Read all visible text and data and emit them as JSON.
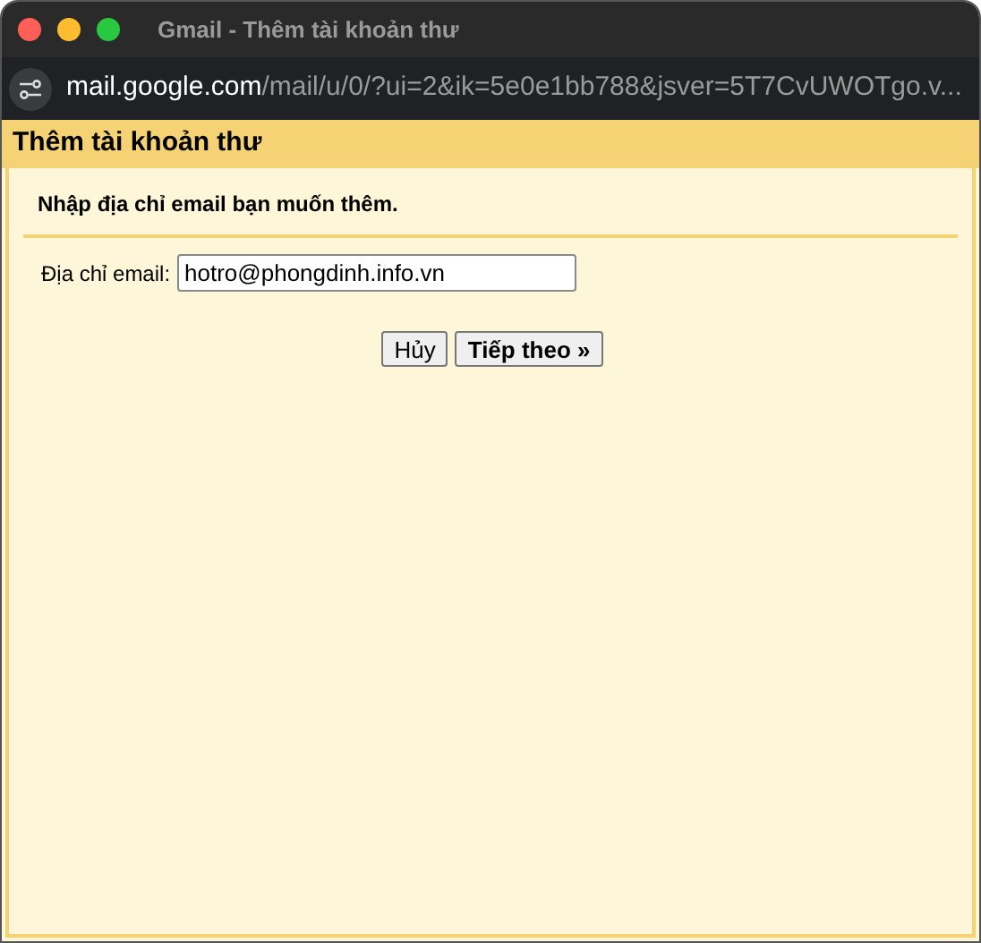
{
  "window": {
    "title": "Gmail - Thêm tài khoản thư"
  },
  "address_bar": {
    "host": "mail.google.com",
    "path": "/mail/u/0/?ui=2&ik=5e0e1bb788&jsver=5T7CvUWOTgo.v..."
  },
  "dialog": {
    "title": "Thêm tài khoản thư",
    "instruction": "Nhập địa chỉ email bạn muốn thêm.",
    "email_label": "Địa chỉ email:",
    "email_value": "hotro@phongdinh.info.vn"
  },
  "buttons": [
    {
      "label": "Hủy",
      "primary": false
    },
    {
      "label": "Tiếp theo »",
      "primary": true
    }
  ]
}
